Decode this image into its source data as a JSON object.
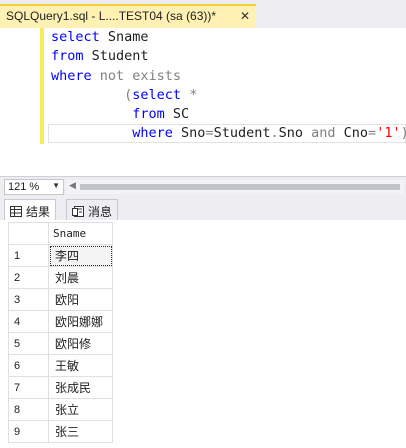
{
  "document_tab": {
    "title": "SQLQuery1.sql - L....TEST04 (sa (63))*",
    "close_glyph": "✕"
  },
  "editor": {
    "lines": [
      {
        "indent": "",
        "tokens": [
          {
            "t": "select",
            "c": "kw"
          },
          {
            "t": " Sname",
            "c": "ident"
          }
        ]
      },
      {
        "indent": "",
        "tokens": [
          {
            "t": "from",
            "c": "kw"
          },
          {
            "t": " Student",
            "c": "ident"
          }
        ]
      },
      {
        "indent": "",
        "tokens": [
          {
            "t": "where",
            "c": "kw"
          },
          {
            "t": " not exists",
            "c": "gray"
          }
        ]
      },
      {
        "indent": "         ",
        "tokens": [
          {
            "t": "(",
            "c": "gray"
          },
          {
            "t": "select",
            "c": "kw"
          },
          {
            "t": " *",
            "c": "gray"
          }
        ]
      },
      {
        "indent": "          ",
        "tokens": [
          {
            "t": "from",
            "c": "kw"
          },
          {
            "t": " SC",
            "c": "ident"
          }
        ]
      },
      {
        "indent": "          ",
        "tokens": [
          {
            "t": "where",
            "c": "kw"
          },
          {
            "t": " Sno",
            "c": "ident"
          },
          {
            "t": "=",
            "c": "gray"
          },
          {
            "t": "Student",
            "c": "ident"
          },
          {
            "t": ".",
            "c": "gray"
          },
          {
            "t": "Sno",
            "c": "ident"
          },
          {
            "t": " and ",
            "c": "gray"
          },
          {
            "t": "Cno",
            "c": "ident"
          },
          {
            "t": "=",
            "c": "gray"
          },
          {
            "t": "'1'",
            "c": "str"
          },
          {
            "t": ");",
            "c": "gray"
          }
        ]
      }
    ]
  },
  "zoom": {
    "value": "121 %"
  },
  "result_tabs": [
    {
      "label": "结果",
      "icon": "grid-icon",
      "active": true
    },
    {
      "label": "消息",
      "icon": "message-icon",
      "active": false
    }
  ],
  "results": {
    "columns": [
      "Sname"
    ],
    "rows": [
      {
        "num": "1",
        "Sname": "李四"
      },
      {
        "num": "2",
        "Sname": "刘晨"
      },
      {
        "num": "3",
        "Sname": "欧阳"
      },
      {
        "num": "4",
        "Sname": "欧阳娜娜"
      },
      {
        "num": "5",
        "Sname": "欧阳修"
      },
      {
        "num": "6",
        "Sname": "王敏"
      },
      {
        "num": "7",
        "Sname": "张成民"
      },
      {
        "num": "8",
        "Sname": "张立"
      },
      {
        "num": "9",
        "Sname": "张三"
      }
    ]
  },
  "colors": {
    "keyword": "#0000ff",
    "operator": "#808080",
    "string": "#ff0000",
    "tab_accent": "#f5cc3a",
    "change_bar": "#f7ed5c"
  }
}
